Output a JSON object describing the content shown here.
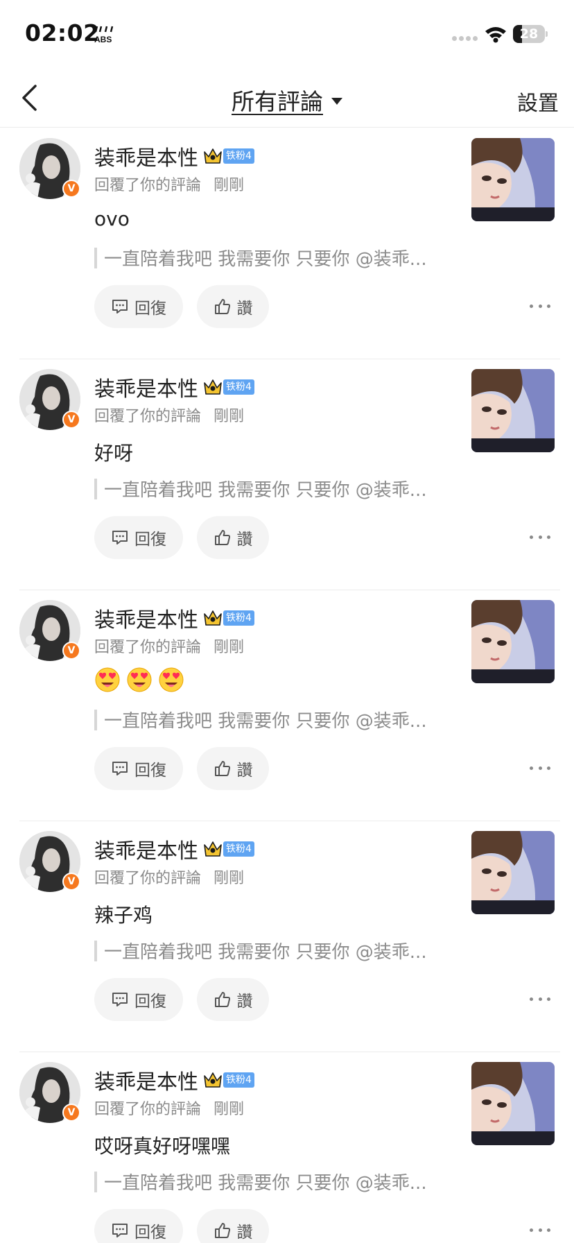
{
  "status_bar": {
    "time": "02:02",
    "extra_icon": "abs-signal-icon",
    "battery_percent": "28",
    "battery_level": 0.28
  },
  "nav": {
    "title": "所有評論",
    "settings": "設置"
  },
  "colors": {
    "accent_orange": "#f6781e",
    "fan_badge_blue": "#5fa4f2"
  },
  "comments": [
    {
      "user_name": "装乖是本性",
      "fan_badge": "铁粉4",
      "action_text": "回覆了你的評論",
      "time": "剛剛",
      "content": "ovo",
      "content_emojis": [],
      "quote": "一直陪着我吧 我需要你 只要你 @装乖...",
      "reply_label": "回復",
      "like_label": "讚"
    },
    {
      "user_name": "装乖是本性",
      "fan_badge": "铁粉4",
      "action_text": "回覆了你的評論",
      "time": "剛剛",
      "content": "好呀",
      "content_emojis": [],
      "quote": "一直陪着我吧 我需要你 只要你 @装乖...",
      "reply_label": "回復",
      "like_label": "讚"
    },
    {
      "user_name": "装乖是本性",
      "fan_badge": "铁粉4",
      "action_text": "回覆了你的評論",
      "time": "剛剛",
      "content": "",
      "content_emojis": [
        "heart-eyes-emoji",
        "heart-eyes-emoji",
        "heart-eyes-emoji"
      ],
      "quote": "一直陪着我吧 我需要你 只要你 @装乖...",
      "reply_label": "回復",
      "like_label": "讚"
    },
    {
      "user_name": "装乖是本性",
      "fan_badge": "铁粉4",
      "action_text": "回覆了你的評論",
      "time": "剛剛",
      "content": "辣子鸡",
      "content_emojis": [],
      "quote": "一直陪着我吧 我需要你 只要你 @装乖...",
      "reply_label": "回復",
      "like_label": "讚"
    },
    {
      "user_name": "装乖是本性",
      "fan_badge": "铁粉4",
      "action_text": "回覆了你的評論",
      "time": "剛剛",
      "content": "哎呀真好呀嘿嘿",
      "content_emojis": [],
      "quote": "一直陪着我吧 我需要你 只要你 @装乖...",
      "reply_label": "回復",
      "like_label": "讚"
    }
  ]
}
